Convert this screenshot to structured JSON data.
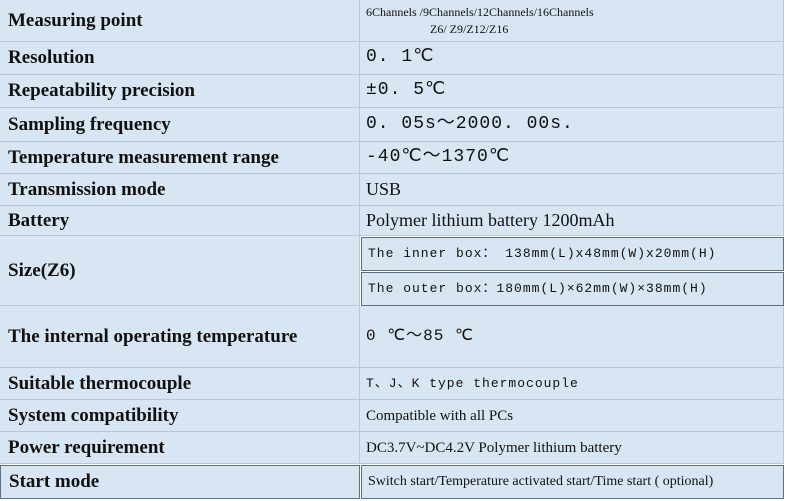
{
  "rows": [
    {
      "label": "Measuring point",
      "value_line1": "6Channels /9Channels/12Channels/16Channels",
      "value_line2": "Z6/ Z9/Z12/Z16"
    },
    {
      "label": "Resolution",
      "value": "0. 1℃"
    },
    {
      "label": "Repeatability precision",
      "value": "±0. 5℃"
    },
    {
      "label": "Sampling frequency",
      "value": "0. 05s～2000. 00s."
    },
    {
      "label": "Temperature measurement range",
      "value": "-40℃～1370℃"
    },
    {
      "label": "Transmission mode",
      "value": "USB"
    },
    {
      "label": "Battery",
      "value": "Polymer lithium battery 1200mAh"
    },
    {
      "label": "Size(Z6)",
      "value_inner": "The inner box： 138mm(L)x48mm(W)x20mm(H)",
      "value_outer": "The outer box：180mm(L)×62mm(W)×38mm(H)"
    },
    {
      "label": "The internal operating temperature",
      "value": "0 ℃～85 ℃"
    },
    {
      "label": "Suitable thermocouple",
      "value": "T、J、K type thermocouple"
    },
    {
      "label": "System compatibility",
      "value": "Compatible with all PCs"
    },
    {
      "label": "Power requirement",
      "value": "DC3.7V~DC4.2V Polymer lithium battery"
    },
    {
      "label": "Start mode",
      "value": "Switch start/Temperature activated start/Time start ( optional)"
    }
  ]
}
